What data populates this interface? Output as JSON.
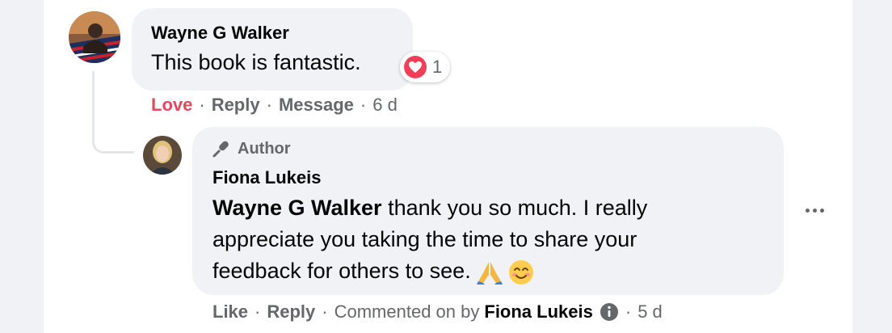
{
  "comment": {
    "author": "Wayne G Walker",
    "text": "This book is fantastic.",
    "reaction": {
      "icon": "heart-reaction-icon",
      "count": "1",
      "color": "#f33e58"
    },
    "actions": {
      "love": "Love",
      "reply": "Reply",
      "message": "Message",
      "time": "6 d",
      "separator": "·"
    }
  },
  "reply": {
    "badge": {
      "icon": "microphone-icon",
      "label": "Author"
    },
    "author": "Fiona Lukeis",
    "mention": "Wayne G Walker",
    "text": " thank you so much. I really appreciate you taking the time to share your feedback for others to see.",
    "emojis": [
      "folded-hands-emoji",
      "smiling-face-emoji"
    ],
    "actions": {
      "like": "Like",
      "reply": "Reply",
      "commented_on_by": "Commented on by",
      "commenter": "Fiona Lukeis",
      "info_icon": "info-icon",
      "time": "5 d",
      "separator": "·"
    },
    "more_icon": "more-options-icon"
  },
  "colors": {
    "love": "#e4485d",
    "bubble": "#f0f2f5",
    "meta": "#65676b"
  }
}
